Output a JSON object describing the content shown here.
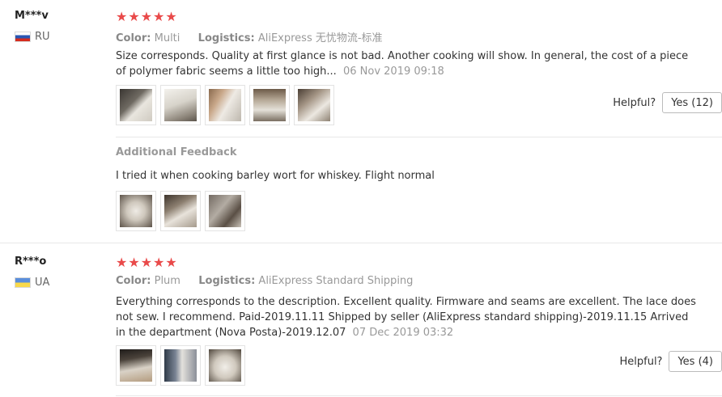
{
  "reviews": [
    {
      "user": "M***v",
      "country": "RU",
      "flag_icon": "flag-ru-icon",
      "stars": 5,
      "color_label": "Color:",
      "color_value": "Multi",
      "logistics_label": "Logistics:",
      "logistics_value": "AliExpress 无忧物流-标准",
      "text": "Size corresponds. Quality at first glance is not bad. Another cooking will show. In general, the cost of a piece of polymer fabric seems a little too high...",
      "date": "06 Nov 2019 09:18",
      "photos": 5,
      "helpful_label": "Helpful?",
      "yes_label": "Yes (12)",
      "additional_title": "Additional Feedback",
      "additional_text": "I tried it when cooking barley wort for whiskey. Flight normal",
      "additional_photos": 3
    },
    {
      "user": "R***o",
      "country": "UA",
      "flag_icon": "flag-ua-icon",
      "stars": 5,
      "color_label": "Color:",
      "color_value": "Plum",
      "logistics_label": "Logistics:",
      "logistics_value": "AliExpress Standard Shipping",
      "text": "Everything corresponds to the description. Excellent quality. Firmware and seams are excellent. The lace does not sew. I recommend. Paid-2019.11.11 Shipped by seller (AliExpress standard shipping)-2019.11.15 Arrived in the department (Nova Posta)-2019.12.07",
      "date": "07 Dec 2019 03:32",
      "photos": 3,
      "helpful_label": "Helpful?",
      "yes_label": "Yes (4)"
    }
  ],
  "colors": {
    "star": "#e94a4a",
    "muted": "#999999",
    "text": "#333333"
  }
}
